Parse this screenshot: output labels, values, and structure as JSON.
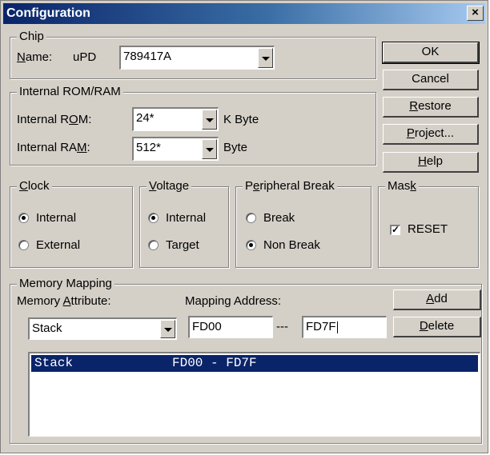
{
  "window": {
    "title": "Configuration",
    "close_glyph": "×"
  },
  "chip": {
    "group_label": "Chip",
    "name_label": "Name:",
    "name_prefix": "uPD",
    "name_value": "789417A"
  },
  "rom_ram": {
    "group_label": "Internal ROM/RAM",
    "rom_label": "Internal ROM:",
    "rom_value": "24*",
    "rom_unit": "K Byte",
    "ram_label": "Internal RAM:",
    "ram_value": "512*",
    "ram_unit": "Byte"
  },
  "buttons": {
    "ok": "OK",
    "cancel": "Cancel",
    "restore": "Restore",
    "project": "Project...",
    "help": "Help"
  },
  "clock": {
    "group_label": "Clock",
    "options": [
      "Internal",
      "External"
    ],
    "selected": "Internal"
  },
  "voltage": {
    "group_label": "Voltage",
    "options": [
      "Internal",
      "Target"
    ],
    "selected": "Internal"
  },
  "peripheral_break": {
    "group_label": "Peripheral Break",
    "options": [
      "Break",
      "Non Break"
    ],
    "selected": "Non Break"
  },
  "mask": {
    "group_label": "Mask",
    "reset_label": "RESET",
    "reset_checked": true
  },
  "memory_mapping": {
    "group_label": "Memory Mapping",
    "attribute_label": "Memory Attribute:",
    "address_label": "Mapping Address:",
    "attribute_value": "Stack",
    "start_address": "FD00",
    "separator": "---",
    "end_address": "FD7F",
    "add_button": "Add",
    "delete_button": "Delete",
    "entries": [
      {
        "attribute": "Stack",
        "range": "FD00 - FD7F"
      }
    ]
  },
  "colors": {
    "dialog_face": "#d4d0c8",
    "title_bar_start": "#0a246a",
    "title_bar_end": "#a6caf0",
    "selection": "#0a246a"
  }
}
